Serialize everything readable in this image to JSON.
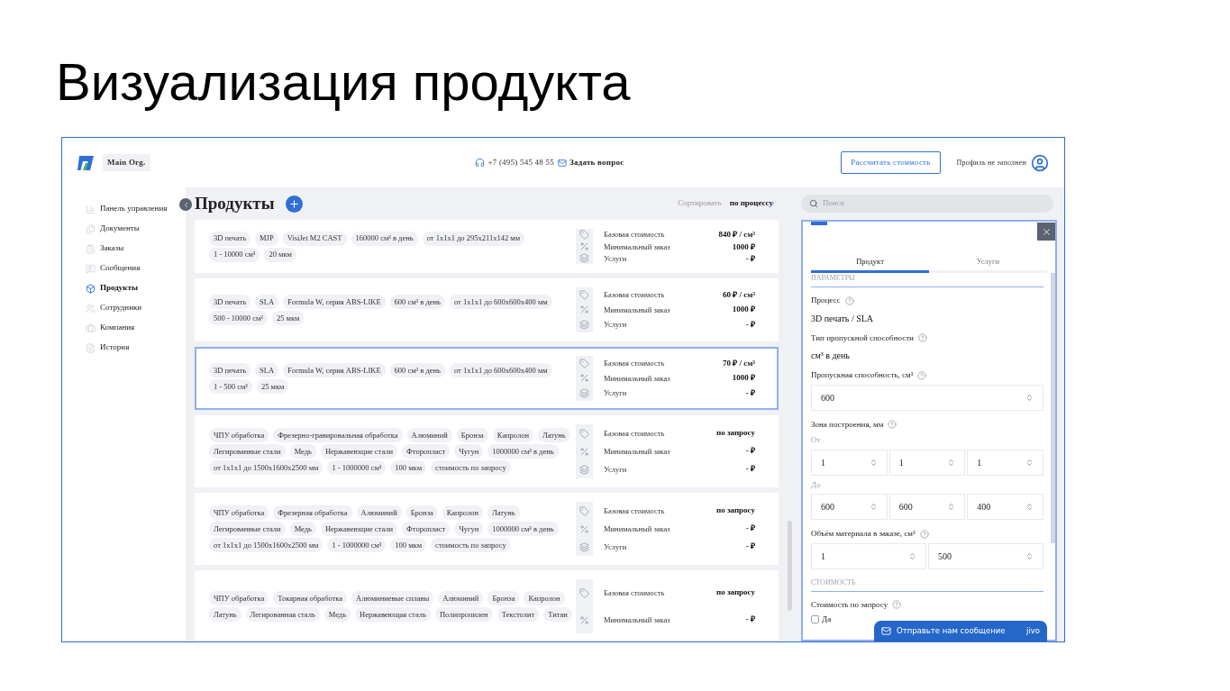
{
  "slide_title": "Визуализация продукта",
  "header": {
    "org": "Main Org.",
    "phone": "+7 (495) 545 48 55",
    "ask": "Задать вопрос",
    "calc_button": "Рассчитать стоимость",
    "profile": "Профиль не заполнен"
  },
  "sidebar": {
    "items": [
      {
        "label": "Панель управления",
        "selected": false
      },
      {
        "label": "Документы",
        "selected": false
      },
      {
        "label": "Заказы",
        "selected": false
      },
      {
        "label": "Сообщения",
        "selected": false
      },
      {
        "label": "Продукты",
        "selected": true
      },
      {
        "label": "Сотрудники",
        "selected": false
      },
      {
        "label": "Компания",
        "selected": false
      },
      {
        "label": "История",
        "selected": false
      }
    ]
  },
  "page": {
    "title": "Продукты",
    "sort_label": "Сортировать",
    "sort_value": "по процессу",
    "search_placeholder": "Поиск"
  },
  "products": [
    {
      "selected": false,
      "tags": [
        "3D печать",
        "MJP",
        "VisiJet M2 CAST",
        "160000 см³ в день",
        "от 1x1x1 до 295x211x142 мм",
        "1 - 10000 см³",
        "20 мкм"
      ],
      "prices": [
        {
          "kind": "base",
          "label": "Базовая стоимость",
          "value": "840 ₽ / см³"
        },
        {
          "kind": "min",
          "label": "Минимальный заказ",
          "value": "1000 ₽"
        },
        {
          "kind": "services",
          "label": "Услуги",
          "value": "- ₽"
        }
      ]
    },
    {
      "selected": false,
      "tags": [
        "3D печать",
        "SLA",
        "Formula W, серия ABS-LIKE",
        "600 см³ в день",
        "от 1x1x1 до 600x600x400 мм",
        "500 - 10000 см³",
        "25 мкм"
      ],
      "prices": [
        {
          "kind": "base",
          "label": "Базовая стоимость",
          "value": "60 ₽ / см³"
        },
        {
          "kind": "min",
          "label": "Минимальный заказ",
          "value": "1000 ₽"
        },
        {
          "kind": "services",
          "label": "Услуги",
          "value": "- ₽"
        }
      ]
    },
    {
      "selected": true,
      "tags": [
        "3D печать",
        "SLA",
        "Formula W, серия ABS-LIKE",
        "600 см³ в день",
        "от 1x1x1 до 600x600x400 мм",
        "1 - 500 см³",
        "25 мкм"
      ],
      "prices": [
        {
          "kind": "base",
          "label": "Базовая стоимость",
          "value": "70 ₽ / см³"
        },
        {
          "kind": "min",
          "label": "Минимальный заказ",
          "value": "1000 ₽"
        },
        {
          "kind": "services",
          "label": "Услуги",
          "value": "- ₽"
        }
      ]
    },
    {
      "selected": false,
      "tags": [
        "ЧПУ обработка",
        "Фрезерно-гравировальная обработка",
        "Алюминий",
        "Бронза",
        "Капролон",
        "Латунь",
        "Легированные стали",
        "Медь",
        "Нержавеющие стали",
        "Фторопласт",
        "Чугун",
        "1000000 см³ в день",
        "от 1x1x1 до 1500x1600x2500 мм",
        "1 - 1000000 см³",
        "100 мкм",
        "стоимость по запросу"
      ],
      "prices": [
        {
          "kind": "base",
          "label": "Базовая стоимость",
          "value": "по запросу"
        },
        {
          "kind": "min",
          "label": "Минимальный заказ",
          "value": "- ₽"
        },
        {
          "kind": "services",
          "label": "Услуги",
          "value": "- ₽"
        }
      ]
    },
    {
      "selected": false,
      "tags": [
        "ЧПУ обработка",
        "Фрезерная обработка",
        "Алюминий",
        "Бронза",
        "Капролон",
        "Латунь",
        "Легированные стали",
        "Медь",
        "Нержавеющие стали",
        "Фторопласт",
        "Чугун",
        "1000000 см³ в день",
        "от 1x1x1 до 1500x1600x2500 мм",
        "1 - 1000000 см³",
        "100 мкм",
        "стоимость по запросу"
      ],
      "prices": [
        {
          "kind": "base",
          "label": "Базовая стоимость",
          "value": "по запросу"
        },
        {
          "kind": "min",
          "label": "Минимальный заказ",
          "value": "- ₽"
        },
        {
          "kind": "services",
          "label": "Услуги",
          "value": "- ₽"
        }
      ]
    },
    {
      "selected": false,
      "tags": [
        "ЧПУ обработка",
        "Токарная обработка",
        "Алюминиевые сплавы",
        "Алюминий",
        "Бронза",
        "Капролон",
        "Латунь",
        "Легированная сталь",
        "Медь",
        "Нержавеющая сталь",
        "Полипропилен",
        "Текстолит",
        "Титан"
      ],
      "prices": [
        {
          "kind": "base",
          "label": "Базовая стоимость",
          "value": "по запросу"
        },
        {
          "kind": "min",
          "label": "Минимальный заказ",
          "value": "- ₽"
        }
      ]
    }
  ],
  "panel": {
    "tabs": [
      {
        "label": "Продукт",
        "selected": true
      },
      {
        "label": "Услуги",
        "selected": false
      }
    ],
    "fields": [
      {
        "kind": "section",
        "label": "ПАРАМЕТРЫ"
      },
      {
        "kind": "info",
        "label": "Процесс",
        "value": "3D печать / SLA"
      },
      {
        "kind": "info",
        "label": "Тип пропускной способности",
        "value": "см³ в день"
      },
      {
        "kind": "inputs",
        "label": "Пропускная способность, см³",
        "rows": [
          {
            "inputs": [
              "600"
            ]
          }
        ]
      },
      {
        "kind": "inputs",
        "label": "Зона построения, мм",
        "rows": [
          {
            "caption": "От",
            "inputs": [
              "1",
              "1",
              "1"
            ]
          },
          {
            "caption": "До",
            "inputs": [
              "600",
              "600",
              "400"
            ]
          }
        ]
      },
      {
        "kind": "inputs",
        "label": "Объём материала в заказе, см³",
        "rows": [
          {
            "inputs": [
              "1",
              "500"
            ]
          }
        ]
      },
      {
        "kind": "section",
        "label": "СТОИМОСТЬ"
      },
      {
        "kind": "checkbox",
        "label": "Стоимость по запросу",
        "option": "Да",
        "checked": false
      }
    ]
  },
  "chat": {
    "text": "Отправьте нам сообщение",
    "brand": "jivo"
  }
}
